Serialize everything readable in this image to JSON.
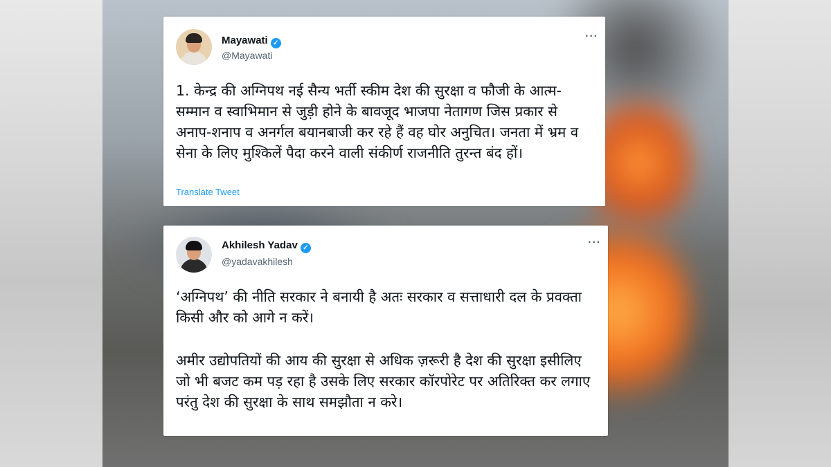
{
  "tweets": [
    {
      "name": "Mayawati",
      "handle": "@Mayawati",
      "text": "1. केन्द्र की अग्निपथ नई सैन्य भर्ती स्कीम देश की सुरक्षा व फौजी के आत्म-सम्मान व स्वाभिमान से जुड़ी होने के बावजूद भाजपा नेतागण जिस प्रकार से अनाप-शनाप व अनर्गल बयानबाजी कर रहे हैं वह घोर अनुचित। जनता में भ्रम व सेना के लिए मुश्किलें पैदा करने वाली संकीर्ण राजनीति तुरन्त बंद हों।",
      "translate": "Translate Tweet",
      "more": "···"
    },
    {
      "name": "Akhilesh Yadav",
      "handle": "@yadavakhilesh",
      "paragraphs": [
        "‘अग्निपथ’ की नीति सरकार ने बनायी है अतः सरकार व सत्ताधारी दल के प्रवक्ता किसी और को आगे न करें।",
        "अमीर उद्योपतियों की आय की सुरक्षा से अधिक ज़रूरी है देश की सुरक्षा इसीलिए जो भी बजट कम पड़ रहा है उसके लिए सरकार कॉरपोरेट पर अतिरिक्त कर लगाए परंतु देश की सुरक्षा के साथ समझौता न करे।"
      ],
      "more": "···"
    }
  ],
  "icons": {
    "verified": "verified-badge-icon",
    "more": "more-options-icon"
  },
  "colors": {
    "verified": "#1d9bf0",
    "link": "#1d9bf0",
    "handle": "#536471",
    "text": "#0f1419"
  }
}
